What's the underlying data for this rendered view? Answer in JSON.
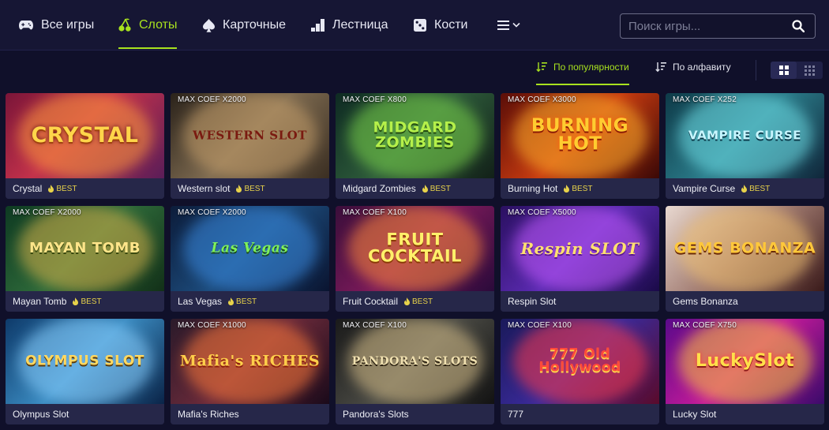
{
  "nav": {
    "items": [
      {
        "label": "Все игры",
        "icon": "gamepad-icon"
      },
      {
        "label": "Слоты",
        "icon": "cherry-icon",
        "active": true
      },
      {
        "label": "Карточные",
        "icon": "spade-icon"
      },
      {
        "label": "Лестница",
        "icon": "ladder-icon"
      },
      {
        "label": "Кости",
        "icon": "dice-icon"
      }
    ],
    "more_icon": "menu-chevron-icon"
  },
  "search": {
    "placeholder": "Поиск игры...",
    "value": "",
    "icon": "search-icon"
  },
  "sort": {
    "options": [
      {
        "label": "По популярности",
        "icon": "sort-popularity-icon",
        "active": true
      },
      {
        "label": "По алфавиту",
        "icon": "sort-alphabet-icon",
        "active": false
      }
    ]
  },
  "view_toggle": {
    "active": "large-grid",
    "options": [
      "large-grid-icon",
      "small-grid-icon"
    ]
  },
  "colors": {
    "accent": "#a8e21e",
    "background": "#10102a",
    "nav_bg": "#161634",
    "card_caption": "#262749",
    "best": "#e7d24a"
  },
  "games": [
    {
      "name": "Crystal",
      "best": "BEST",
      "max_coef": "",
      "logo": "CRYSTAL"
    },
    {
      "name": "Western slot",
      "best": "BEST",
      "max_coef": "MAX COEF X2000",
      "logo": "WESTERN SLOT"
    },
    {
      "name": "Midgard Zombies",
      "best": "BEST",
      "max_coef": "MAX COEF X800",
      "logo": "MIDGARD ZOMBIES"
    },
    {
      "name": "Burning Hot",
      "best": "BEST",
      "max_coef": "MAX COEF X3000",
      "logo": "BURNING HOT"
    },
    {
      "name": "Vampire Curse",
      "best": "BEST",
      "max_coef": "MAX COEF X252",
      "logo": "VAMPIRE CURSE"
    },
    {
      "name": "Mayan Tomb",
      "best": "BEST",
      "max_coef": "MAX COEF X2000",
      "logo": "MAYAN TOMB"
    },
    {
      "name": "Las Vegas",
      "best": "BEST",
      "max_coef": "MAX COEF X2000",
      "logo": "Las Vegas"
    },
    {
      "name": "Fruit Cocktail",
      "best": "BEST",
      "max_coef": "MAX COEF X100",
      "logo": "FRUIT COCKTAIL"
    },
    {
      "name": "Respin Slot",
      "best": "",
      "max_coef": "MAX COEF X5000",
      "logo": "Respin SLOT"
    },
    {
      "name": "Gems Bonanza",
      "best": "",
      "max_coef": "",
      "logo": "GEMS BONANZA"
    },
    {
      "name": "Olympus Slot",
      "best": "",
      "max_coef": "",
      "logo": "OLYMPUS SLOT"
    },
    {
      "name": "Mafia's Riches",
      "best": "",
      "max_coef": "MAX COEF X1000",
      "logo": "Mafia's RICHES"
    },
    {
      "name": "Pandora's Slots",
      "best": "",
      "max_coef": "MAX COEF X100",
      "logo": "PANDORA'S SLOTS"
    },
    {
      "name": "777",
      "best": "",
      "max_coef": "MAX COEF X100",
      "logo": "777 Old Hollywood"
    },
    {
      "name": "Lucky Slot",
      "best": "",
      "max_coef": "MAX COEF X750",
      "logo": "LuckySlot"
    }
  ]
}
